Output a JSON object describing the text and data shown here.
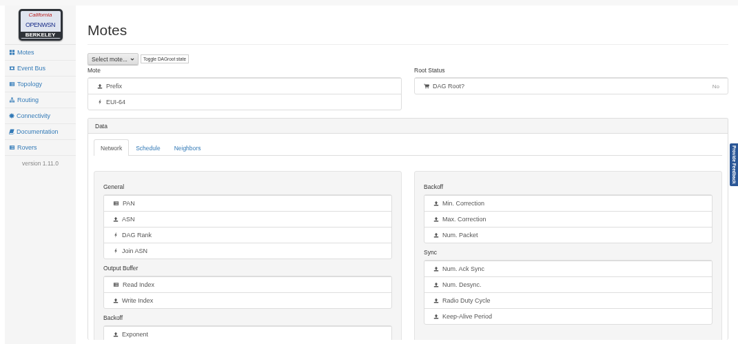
{
  "logo": {
    "script": "California",
    "name": "OPENWSN",
    "city": "BERKELEY"
  },
  "sidebar": {
    "items": [
      {
        "label": "Motes",
        "kind": "grid"
      },
      {
        "label": "Event Bus",
        "kind": "ticket"
      },
      {
        "label": "Topology",
        "kind": "list"
      },
      {
        "label": "Routing",
        "kind": "sitemap"
      },
      {
        "label": "Connectivity",
        "kind": "asterisk"
      },
      {
        "label": "Documentation",
        "kind": "book"
      },
      {
        "label": "Rovers",
        "kind": "list"
      }
    ],
    "version": "version 1.11.0"
  },
  "page": {
    "title": "Motes"
  },
  "toolbar": {
    "mote_select": "Select mote...",
    "toggle_button": "Toggle DAGroot state"
  },
  "mote": {
    "label": "Mote",
    "rows": [
      {
        "kind": "upload",
        "label": "Prefix"
      },
      {
        "kind": "bolt",
        "label": "EUI-64"
      }
    ]
  },
  "root_status": {
    "label": "Root Status",
    "rows": [
      {
        "kind": "cart",
        "label": "DAG Root?",
        "value": "No"
      }
    ]
  },
  "data_panel": {
    "title": "Data",
    "tabs": [
      {
        "label": "Network",
        "selected": true
      },
      {
        "label": "Schedule",
        "selected": false
      },
      {
        "label": "Neighbors",
        "selected": false
      }
    ],
    "columns": [
      [
        {
          "title": "General",
          "rows": [
            {
              "kind": "list",
              "label": "PAN"
            },
            {
              "kind": "upload",
              "label": "ASN"
            },
            {
              "kind": "bolt",
              "label": "DAG Rank"
            },
            {
              "kind": "bolt",
              "label": "Join ASN"
            }
          ]
        },
        {
          "title": "Output Buffer",
          "rows": [
            {
              "kind": "list",
              "label": "Read Index"
            },
            {
              "kind": "upload",
              "label": "Write Index"
            }
          ]
        },
        {
          "title": "Backoff",
          "rows": [
            {
              "kind": "upload",
              "label": "Exponent"
            }
          ]
        }
      ],
      [
        {
          "title": "Backoff",
          "rows": [
            {
              "kind": "upload",
              "label": "Min. Correction"
            },
            {
              "kind": "upload",
              "label": "Max. Correction"
            },
            {
              "kind": "upload",
              "label": "Num. Packet"
            }
          ]
        },
        {
          "title": "Sync",
          "rows": [
            {
              "kind": "upload",
              "label": "Num. Ack Sync"
            },
            {
              "kind": "upload",
              "label": "Num. Desync."
            },
            {
              "kind": "upload",
              "label": "Radio Duty Cycle"
            },
            {
              "kind": "upload",
              "label": "Keep-Alive Period"
            }
          ]
        }
      ]
    ]
  },
  "feedback": {
    "label": "Provide Feedback"
  }
}
